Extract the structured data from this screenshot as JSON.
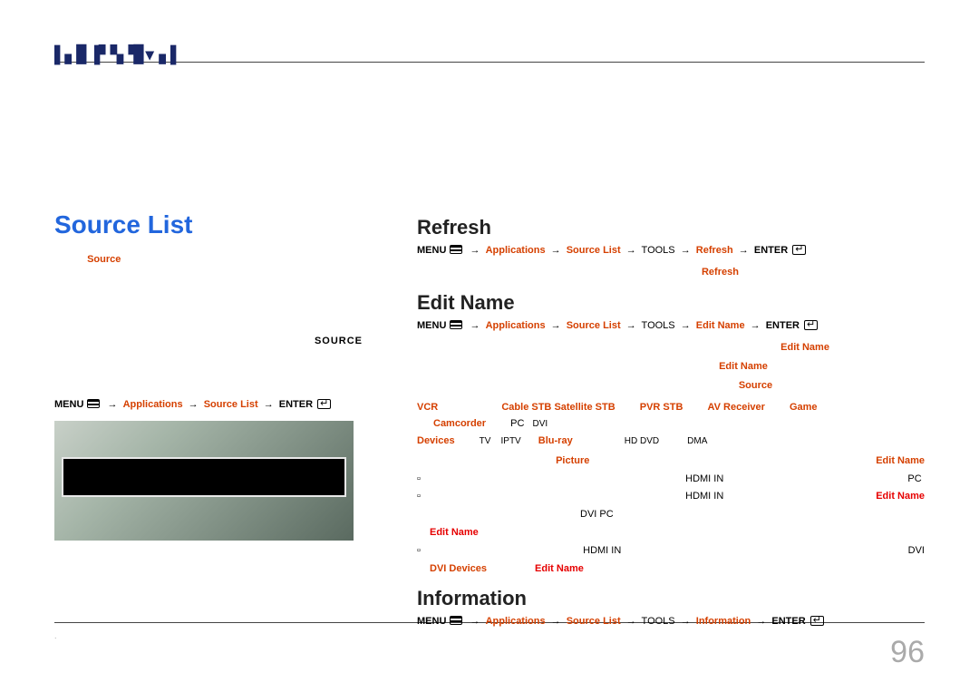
{
  "logo": "▌▖▊▐▘▚▝▊▾▗▐",
  "page_number": "96",
  "left": {
    "heading": "Source List",
    "source_label": "Source",
    "source_caps": "SOURCE",
    "path": {
      "menu": "MENU",
      "m_icon": "m",
      "applications": "Applications",
      "source_list": "Source List",
      "enter": "ENTER"
    }
  },
  "right": {
    "refresh": {
      "heading": "Refresh",
      "path": {
        "menu": "MENU",
        "m_icon": "m",
        "applications": "Applications",
        "source_list": "Source List",
        "tools": "TOOLS",
        "refresh": "Refresh",
        "enter": "ENTER"
      },
      "kw_refresh": "Refresh"
    },
    "editname": {
      "heading": "Edit Name",
      "path": {
        "menu": "MENU",
        "m_icon": "m",
        "applications": "Applications",
        "source_list": "Source List",
        "tools": "TOOLS",
        "editname": "Edit Name",
        "enter": "ENTER"
      },
      "kw_editname1": "Edit Name",
      "kw_editname2": "Edit Name",
      "kw_source": "Source",
      "devices": [
        "VCR",
        "Cable STB",
        "Satellite STB",
        "PVR STB",
        "AV Receiver",
        "Game",
        "Camcorder",
        "PC",
        "DVI",
        "Devices",
        "TV",
        "IPTV",
        "Blu-ray",
        "HD DVD",
        "DMA"
      ],
      "picture_kw": "Picture",
      "editname_kw3": "Edit Name",
      "bullets": {
        "b1_hdmin": "HDMI IN",
        "b1_pc": "PC",
        "b1_editname": "Edit Name",
        "b2_hdmin": "HDMI IN",
        "b2_dvi": "DVI PC",
        "b2_editname": "Edit Name",
        "b3_hdmin": "HDMI IN",
        "b3_dvi": "DVI Devices",
        "b3_editname": "Edit Name"
      }
    },
    "information": {
      "heading": "Information",
      "path": {
        "menu": "MENU",
        "m_icon": "m",
        "applications": "Applications",
        "source_list": "Source List",
        "tools": "TOOLS",
        "information": "Information",
        "enter": "ENTER"
      }
    }
  }
}
